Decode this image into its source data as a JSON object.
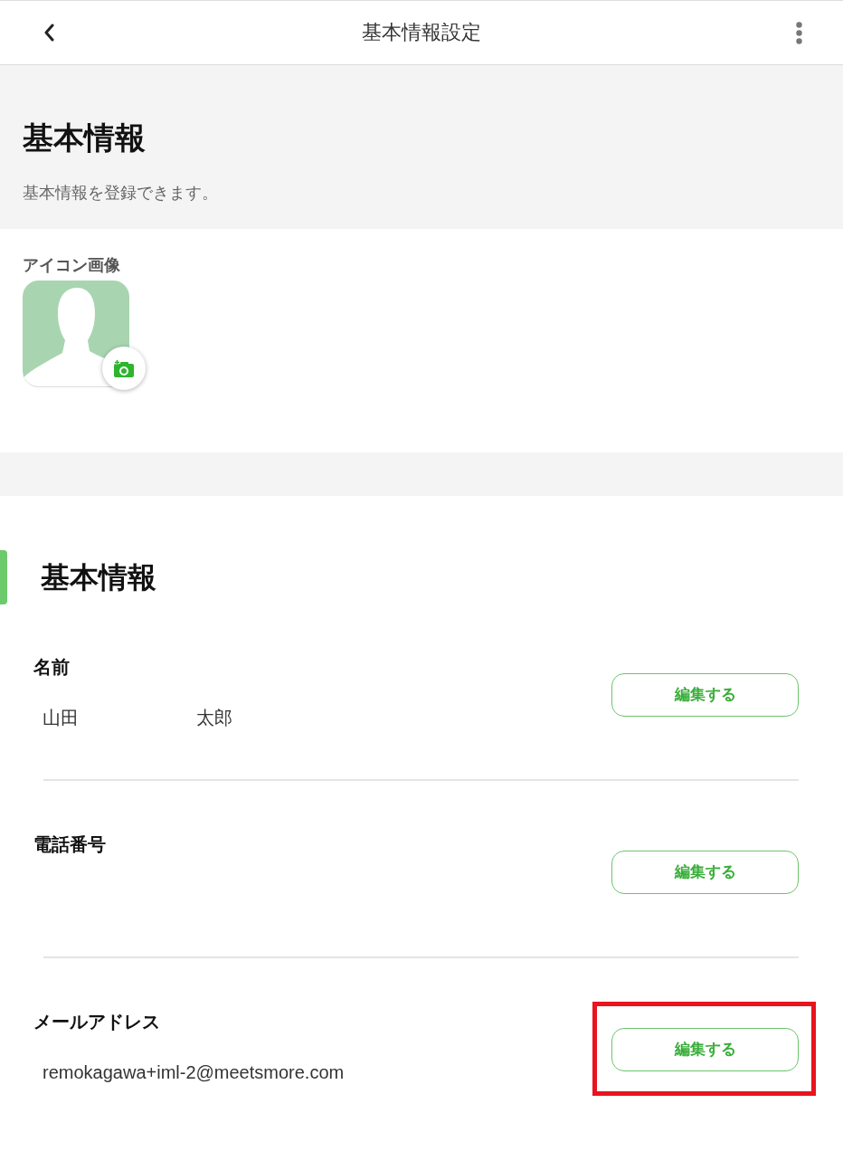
{
  "header": {
    "title": "基本情報設定"
  },
  "intro": {
    "heading": "基本情報",
    "description": "基本情報を登録できます。"
  },
  "icon_image": {
    "label": "アイコン画像"
  },
  "section": {
    "heading": "基本情報",
    "fields": [
      {
        "label": "名前",
        "values": [
          "山田",
          "太郎"
        ],
        "button": "編集する",
        "highlighted": false
      },
      {
        "label": "電話番号",
        "button": "編集する",
        "highlighted": false
      },
      {
        "label": "メールアドレス",
        "values": [
          "remokagawa+iml-2@meetsmore.com"
        ],
        "button": "編集する",
        "highlighted": true
      }
    ]
  }
}
